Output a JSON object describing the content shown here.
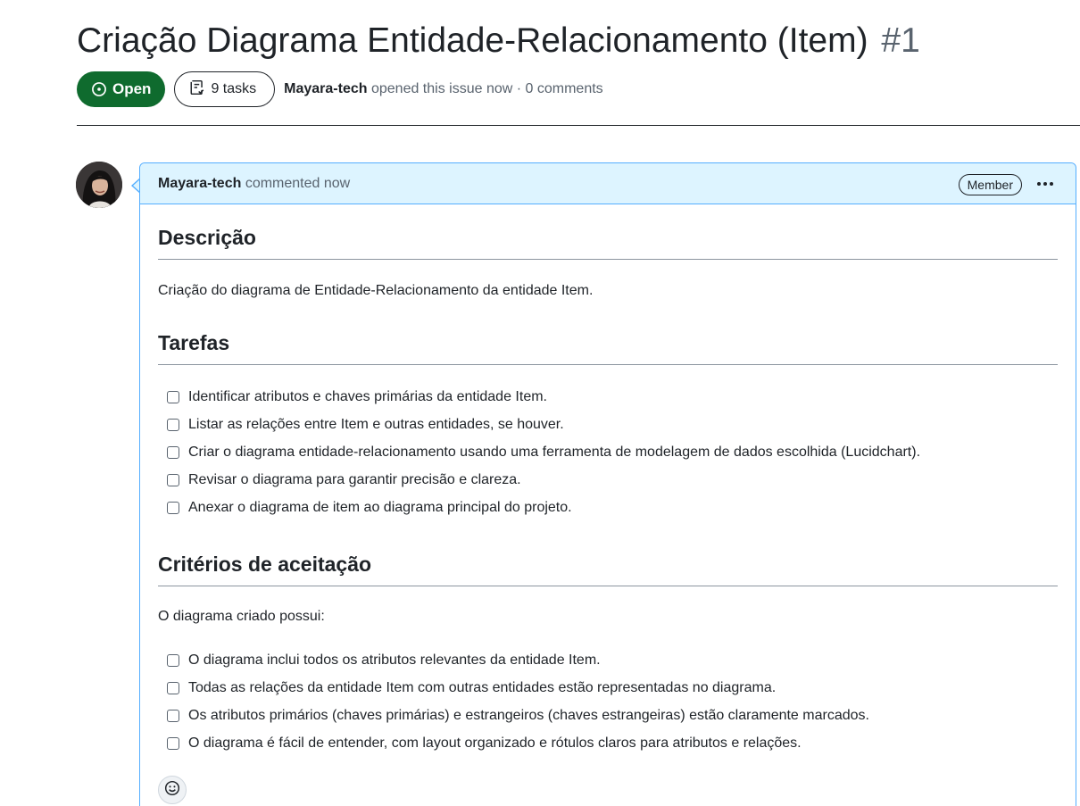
{
  "issue": {
    "title": "Criação Diagrama Entidade-Relacionamento (Item)",
    "number": "#1",
    "state_label": "Open",
    "tasks_label": "9 tasks",
    "author": "Mayara-tech",
    "meta_suffix": "opened this issue now · 0 comments"
  },
  "comment": {
    "author": "Mayara-tech",
    "action": "commented now",
    "badge": "Member",
    "sections": {
      "descricao": {
        "heading": "Descrição",
        "text": "Criação do diagrama de Entidade-Relacionamento da entidade Item."
      },
      "tarefas": {
        "heading": "Tarefas",
        "items": [
          "Identificar atributos e chaves primárias da entidade Item.",
          "Listar as relações entre Item e outras entidades, se houver.",
          "Criar o diagrama entidade-relacionamento usando uma ferramenta de modelagem de dados escolhida (Lucidchart).",
          "Revisar o diagrama para garantir precisão e clareza.",
          "Anexar o diagrama de item ao diagrama principal do projeto."
        ]
      },
      "criterios": {
        "heading": "Critérios de aceitação",
        "intro": "O diagrama criado possui:",
        "items": [
          "O diagrama inclui todos os atributos relevantes da entidade Item.",
          "Todas as relações da entidade Item com outras entidades estão representadas no diagrama.",
          "Os atributos primários (chaves primárias) e estrangeiros (chaves estrangeiras) estão claramente marcados.",
          "O diagrama é fácil de entender, com layout organizado e rótulos claros para atributos e relações."
        ]
      }
    }
  },
  "icons": {
    "state": "issue-opened-icon",
    "tasks": "checklist-icon",
    "menu": "kebab-horizontal-icon",
    "reaction": "smiley-icon"
  },
  "colors": {
    "open_green": "#0f6b2e",
    "header_blue": "#ddf4ff",
    "border_blue": "#54aeff"
  }
}
